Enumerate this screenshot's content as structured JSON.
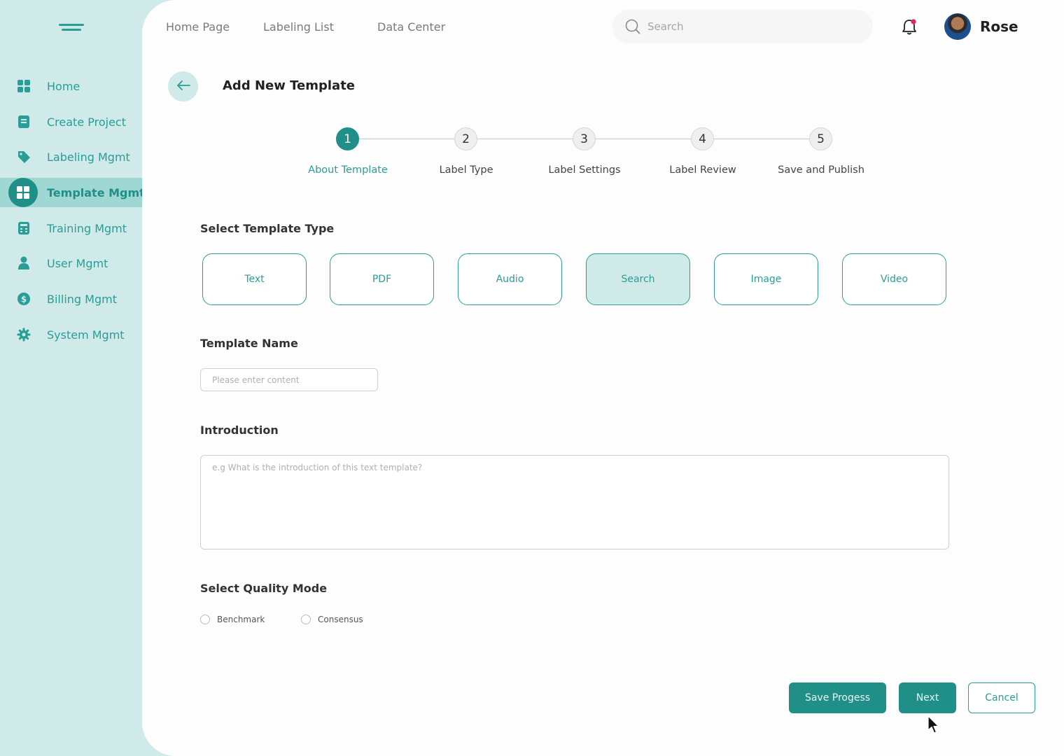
{
  "colors": {
    "accent": "#1f8f88",
    "accent_light": "#cfeae8",
    "notification_dot": "#e0245e"
  },
  "sidebar": {
    "items": [
      {
        "label": "Home",
        "icon": "grid-icon"
      },
      {
        "label": "Create Project",
        "icon": "document-icon"
      },
      {
        "label": "Labeling Mgmt",
        "icon": "tag-icon"
      },
      {
        "label": "Template Mgmt",
        "icon": "template-icon",
        "active": true
      },
      {
        "label": "Training Mgmt",
        "icon": "calculator-icon"
      },
      {
        "label": "User Mgmt",
        "icon": "user-icon"
      },
      {
        "label": "Billing Mgmt",
        "icon": "dollar-icon"
      },
      {
        "label": "System Mgmt",
        "icon": "gear-icon"
      }
    ]
  },
  "header": {
    "nav": [
      "Home Page",
      "Labeling List",
      "Data Center"
    ],
    "search_placeholder": "Search",
    "username": "Rose"
  },
  "page": {
    "title": "Add New Template"
  },
  "stepper": {
    "current": 1,
    "steps": [
      {
        "number": "1",
        "label": "About Template"
      },
      {
        "number": "2",
        "label": "Label Type"
      },
      {
        "number": "3",
        "label": "Label Settings"
      },
      {
        "number": "4",
        "label": "Label Review"
      },
      {
        "number": "5",
        "label": "Save and Publish"
      }
    ]
  },
  "form": {
    "template_type": {
      "title": "Select Template Type",
      "options": [
        "Text",
        "PDF",
        "Audio",
        "Search",
        "Image",
        "Video"
      ],
      "selected": "Search"
    },
    "template_name": {
      "title": "Template Name",
      "placeholder": "Please enter content",
      "value": ""
    },
    "introduction": {
      "title": "Introduction",
      "placeholder": "e.g What is the introduction of this text template?",
      "value": ""
    },
    "quality_mode": {
      "title": "Select Quality Mode",
      "options": [
        "Benchmark",
        "Consensus"
      ]
    }
  },
  "actions": {
    "save": "Save Progess",
    "next": "Next",
    "cancel": "Cancel"
  }
}
